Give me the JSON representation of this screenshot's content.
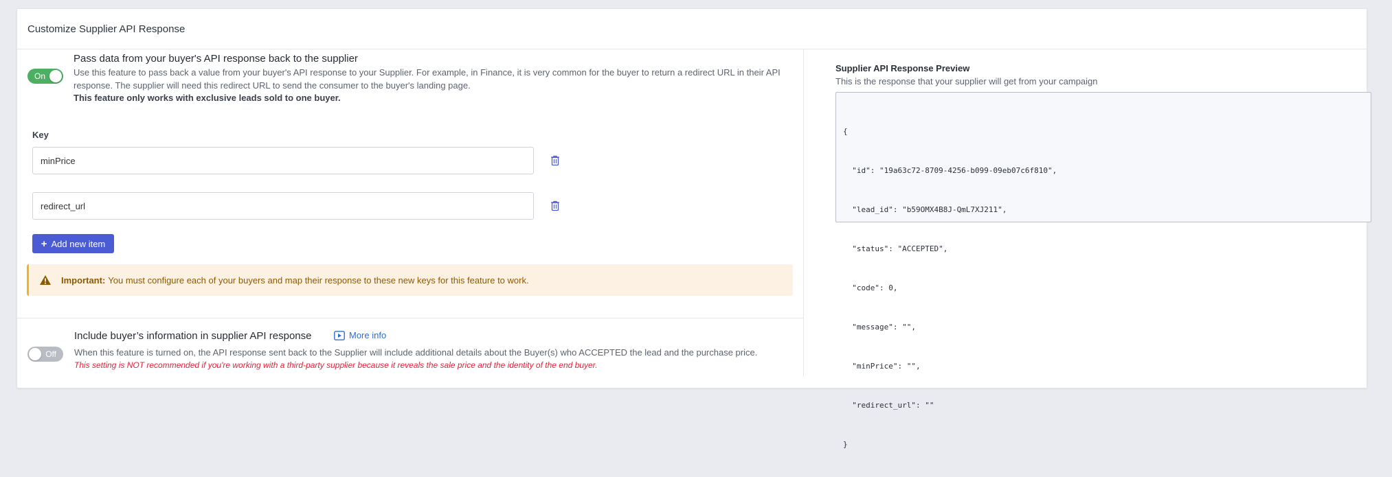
{
  "card": {
    "title": "Customize Supplier API Response"
  },
  "pass_data": {
    "toggle_label": "On",
    "title": "Pass data from your buyer's API response back to the supplier",
    "description_line1": "Use this feature to pass back a value from your buyer's API response to your Supplier. For example, in Finance, it is very common for the buyer to return a redirect URL in their API",
    "description_line2": "response. The supplier will need this redirect URL to send the consumer to the buyer's landing page.",
    "note": "This feature only works with exclusive leads sold to one buyer.",
    "key_label": "Key",
    "keys": [
      "minPrice",
      "redirect_url"
    ],
    "add_button_label": "Add new item",
    "alert_bold": "Important:",
    "alert_text": "You must configure each of your buyers and map their response to these new keys for this feature to work."
  },
  "include_buyer": {
    "toggle_label": "Off",
    "title": "Include buyer’s information in supplier API response",
    "more_info_label": "More info",
    "description": "When this feature is turned on, the API response sent back to the Supplier will include additional details about the Buyer(s) who ACCEPTED the lead and the purchase price.",
    "warning": "This setting is NOT recommended if you're working with a third-party supplier because it reveals the sale price and the identity of the end buyer."
  },
  "preview": {
    "title": "Supplier API Response Preview",
    "subtitle": "This is the response that your supplier will get from your campaign",
    "code_lines": [
      "{",
      "  \"id\": \"19a63c72-8709-4256-b099-09eb07c6f810\",",
      "  \"lead_id\": \"b59OMX4B8J-QmL7XJ211\",",
      "  \"status\": \"ACCEPTED\",",
      "  \"code\": 0,",
      "  \"message\": \"\",",
      "  \"minPrice\": \"\",",
      "  \"redirect_url\": \"\"",
      "}"
    ]
  },
  "colors": {
    "toggle_on": "#4caf62",
    "toggle_off": "#b9bcc3",
    "primary_button": "#4b5bd4",
    "alert_background": "#fdf1e4",
    "alert_border": "#f0b323",
    "warning_red": "#e5213a",
    "link_blue": "#2d6cd2"
  }
}
